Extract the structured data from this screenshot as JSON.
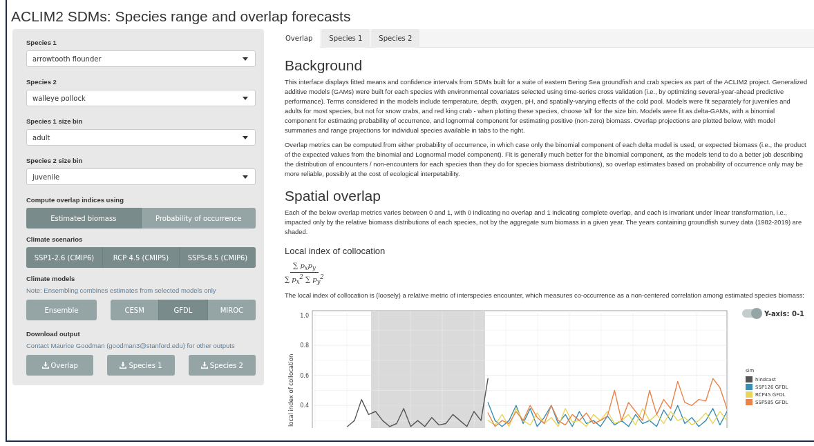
{
  "title": "ACLIM2 SDMs: Species range and overlap forecasts",
  "sidebar": {
    "selects": [
      {
        "label": "Species 1",
        "value": "arrowtooth flounder"
      },
      {
        "label": "Species 2",
        "value": "walleye pollock"
      },
      {
        "label": "Species 1 size bin",
        "value": "adult"
      },
      {
        "label": "Species 2 size bin",
        "value": "juvenile"
      }
    ],
    "overlap_method": {
      "label": "Compute overlap indices using",
      "options": [
        {
          "label": "Estimated biomass",
          "selected": true
        },
        {
          "label": "Probability of occurrence",
          "selected": false
        }
      ]
    },
    "scenarios": {
      "label": "Climate scenarios",
      "options": [
        {
          "label": "SSP1-2.6 (CMIP6)",
          "selected": true
        },
        {
          "label": "RCP 4.5 (CMIP5)",
          "selected": true
        },
        {
          "label": "SSP5-8.5 (CMIP6)",
          "selected": true
        }
      ]
    },
    "models": {
      "label": "Climate models",
      "note": "Note: Ensembling combines estimates from selected models only",
      "ensemble": {
        "label": "Ensemble",
        "selected": false
      },
      "options": [
        {
          "label": "CESM",
          "selected": false
        },
        {
          "label": "GFDL",
          "selected": true
        },
        {
          "label": "MIROC",
          "selected": false
        }
      ]
    },
    "download": {
      "label": "Download output",
      "note": "Contact Maurice Goodman (goodman3@stanford.edu) for other outputs",
      "buttons": [
        "Overlap",
        "Species 1",
        "Species 2"
      ]
    }
  },
  "tabs": [
    {
      "label": "Overlap",
      "selected": true
    },
    {
      "label": "Species 1",
      "selected": false
    },
    {
      "label": "Species 2",
      "selected": false
    }
  ],
  "main": {
    "background_heading": "Background",
    "background_paragraphs": [
      "This interface displays fitted means and confidence intervals from SDMs built for a suite of eastern Bering Sea groundfish and crab species as part of the ACLIM2 project. Generalized additive models (GAMs) were built for each species with environmental covariates selected using time-series cross validation (i.e., by optimizing several-year-ahead predictive performance). Terms considered in the models include temperature, depth, oxygen, pH, and spatially-varying effects of the cold pool. Models were fit separately for juveniles and adults for most species, but not for snow crabs, and red king crab - when plotting these species, choose 'all' for the size bin. Models were fit as delta-GAMs, with a binomial component for estimating probability of occurrence, and lognormal component for estimating positive (non-zero) biomass. Overlap projections are plotted below, with model summaries and range projections for individual species available in tabs to the right.",
      "Overlap metrics can be computed from either probability of occurrence, in which case only the binomial component of each delta model is used, or expected biomass (i.e., the product of the expected values from the binomial and Lognormal model component). Fit is generally much better for the binomial component, as the models tend to do a better job describing the distribution of encounters / non-encounters for each species than they do for species biomass distributions), so overlap estimates based on probability of occurrence only may be more reliable, possibly at the cost of ecological interpetability."
    ],
    "spatial_heading": "Spatial overlap",
    "spatial_paragraph": "Each of the below overlap metrics varies between 0 and 1, with 0 indicating no overlap and 1 indicating complete overlap, and each is invariant under linear transformation, i.e., impacted only by the relative biomass distributions of each species, not by the aggregate sum biomass in a given year. The years containing groundfish survey data (1982-2019) are shaded.",
    "metric_heading": "Local index of collocation",
    "formula": {
      "numerator": "∑ p$_{x}$p$_{y}$",
      "denominator": "∑ p$_{x}$$^{2}$ ∑ p$_{y}$$^{2}$"
    },
    "metric_paragraph": "The local index of collocation is (loosely) a relative metric of interspecies encounter, which measures co-occurrence as a non-centered correlation among estimated species biomass:",
    "yaxis_toggle": {
      "label": "Y-axis: 0-1",
      "on": true
    },
    "chart_data": {
      "type": "line",
      "ylabel": "local index of collocation",
      "ylim": [
        0.25,
        1.03
      ],
      "yticks": [
        {
          "value": 0.4,
          "label": "0.4"
        },
        {
          "value": 0.6,
          "label": "0.6"
        },
        {
          "value": 0.8,
          "label": "0.8"
        },
        {
          "value": 1.0,
          "label": "1.0"
        }
      ],
      "grid": true,
      "legend": "right",
      "legend_title": "sim",
      "series": [
        {
          "name": "hindcast",
          "color": "#555555",
          "values": [
            null,
            null,
            null,
            null,
            null,
            0.26,
            0.3,
            0.44,
            0.34,
            0.36,
            0.3,
            0.26,
            0.28,
            0.38,
            0.26,
            0.3,
            0.26,
            0.32,
            0.27,
            0.28,
            0.34,
            0.3,
            0.26,
            0.36,
            0.3,
            0.58,
            null,
            null,
            null,
            null,
            null,
            null,
            null,
            null,
            null,
            null,
            null,
            null,
            null,
            null,
            null,
            null,
            null,
            null,
            null,
            null,
            null,
            null,
            null,
            null,
            null,
            null,
            null,
            null,
            null,
            null,
            null,
            null,
            null,
            null
          ]
        },
        {
          "name": "SSP126 GFDL",
          "color": "#3a8fb0",
          "values": [
            null,
            null,
            null,
            null,
            null,
            null,
            null,
            null,
            null,
            null,
            null,
            null,
            null,
            null,
            null,
            null,
            null,
            null,
            null,
            null,
            null,
            null,
            null,
            null,
            null,
            0.42,
            0.3,
            0.26,
            0.3,
            0.4,
            0.28,
            0.38,
            0.26,
            0.32,
            0.4,
            0.28,
            0.34,
            0.26,
            0.36,
            0.28,
            0.3,
            0.26,
            0.33,
            0.27,
            0.3,
            0.26,
            0.34,
            0.28,
            0.3,
            0.26,
            0.37,
            0.3,
            0.4,
            0.28,
            0.32,
            0.26,
            0.3,
            0.38,
            0.27,
            0.36
          ]
        },
        {
          "name": "RCP45 GFDL",
          "color": "#e8d55a",
          "values": [
            null,
            null,
            null,
            null,
            null,
            null,
            null,
            null,
            null,
            null,
            null,
            null,
            null,
            null,
            null,
            null,
            null,
            null,
            null,
            null,
            null,
            null,
            null,
            null,
            null,
            0.3,
            0.27,
            0.34,
            0.26,
            0.38,
            0.3,
            0.27,
            0.35,
            0.28,
            0.32,
            0.26,
            0.38,
            0.29,
            0.3,
            0.26,
            0.34,
            0.3,
            0.36,
            0.28,
            0.3,
            0.34,
            0.27,
            0.38,
            0.3,
            0.34,
            0.28,
            0.36,
            0.3,
            0.32,
            0.27,
            0.3,
            0.35,
            0.28,
            0.36,
            0.3
          ]
        },
        {
          "name": "SSP585 GFDL",
          "color": "#e8834a",
          "values": [
            null,
            null,
            null,
            null,
            null,
            null,
            null,
            null,
            null,
            null,
            null,
            null,
            null,
            null,
            null,
            null,
            null,
            null,
            null,
            null,
            null,
            null,
            null,
            null,
            null,
            0.35,
            0.26,
            0.3,
            0.28,
            0.36,
            0.3,
            0.4,
            0.32,
            0.28,
            0.4,
            0.3,
            0.27,
            0.34,
            0.3,
            0.35,
            0.28,
            0.3,
            0.33,
            0.5,
            0.3,
            0.42,
            0.36,
            0.3,
            0.5,
            0.34,
            0.44,
            0.38,
            0.56,
            0.42,
            0.4,
            0.44,
            0.43,
            0.58,
            0.52,
            0.38
          ]
        }
      ]
    }
  }
}
